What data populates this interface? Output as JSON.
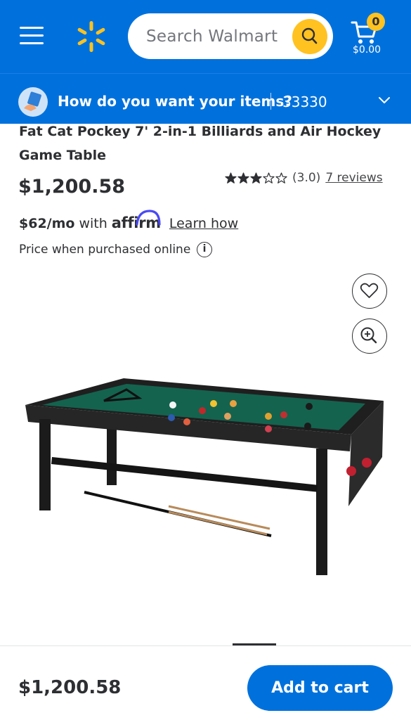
{
  "header": {
    "search_placeholder": "Search Walmart",
    "cart_count": "0",
    "cart_total": "$0.00",
    "brand_color": "#0071dc",
    "accent_color": "#ffc220"
  },
  "delivery": {
    "prompt": "How do you want your items?",
    "zip": "33330"
  },
  "product": {
    "title": "Fat Cat Pockey 7' 2-in-1 Billiards and Air Hockey Game Table",
    "price": "$1,200.58",
    "rating_value": 3.0,
    "rating_text": "(3.0)",
    "reviews_text": "7 reviews",
    "affirm": {
      "monthly": "$62/mo",
      "with": "with",
      "brand": "affirm",
      "learn": "Learn how"
    },
    "price_note": "Price when purchased online",
    "info_glyph": "i"
  },
  "bottom_bar": {
    "price": "$1,200.58",
    "add_to_cart": "Add to cart"
  },
  "icons": [
    "menu-icon",
    "spark-logo-icon",
    "search-icon",
    "cart-icon",
    "delivery-icon",
    "chevron-down-icon",
    "star-icon",
    "info-icon",
    "heart-icon",
    "zoom-in-icon"
  ]
}
